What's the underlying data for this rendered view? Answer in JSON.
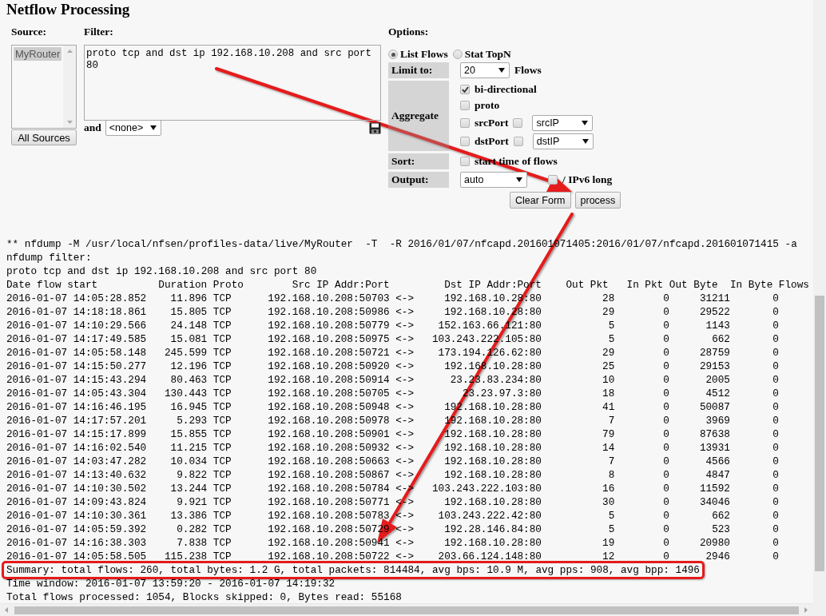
{
  "title": "Netflow Processing",
  "source": {
    "label": "Source:",
    "items": [
      {
        "label": "MyRouter",
        "selected": true
      }
    ],
    "button": "All Sources"
  },
  "filter": {
    "label": "Filter:",
    "value": "proto tcp and dst ip 192.168.10.208 and src port 80",
    "and_label": "and",
    "and_select": "<none>"
  },
  "options": {
    "label": "Options:",
    "modes": [
      {
        "label": "List Flows",
        "selected": true
      },
      {
        "label": "Stat TopN",
        "selected": false
      }
    ],
    "limit": {
      "label": "Limit to:",
      "select": "20",
      "unit": "Flows"
    },
    "aggregate": {
      "label": "Aggregate",
      "items": [
        {
          "kind": "check",
          "label": "bi-directional",
          "checked": true
        },
        {
          "kind": "check",
          "label": "proto",
          "checked": false
        },
        {
          "kind": "check_select",
          "label": "srcPort",
          "checked": false,
          "second_checked": false,
          "select": "srcIP"
        },
        {
          "kind": "check_select",
          "label": "dstPort",
          "checked": false,
          "second_checked": false,
          "select": "dstIP"
        }
      ]
    },
    "sort": {
      "label": "Sort:",
      "checked": false,
      "text": "start time of flows"
    },
    "output": {
      "label": "Output:",
      "select": "auto",
      "ipv6_checked": false,
      "ipv6_label": "/ IPv6 long"
    }
  },
  "buttons": [
    "Clear Form",
    "process"
  ],
  "result": {
    "command": "** nfdump -M /usr/local/nfsen/profiles-data/live/MyRouter  -T  -R 2016/01/07/nfcapd.201601071405:2016/01/07/nfcapd.201601071415 -a",
    "filter_label": "nfdump filter:",
    "filter": "proto tcp and dst ip 192.168.10.208 and src port 80",
    "columns": [
      "Date flow start",
      "Duration",
      "Proto",
      "Src IP Addr:Port",
      "",
      "Dst IP Addr:Port",
      "Out Pkt",
      "In Pkt",
      "Out Byte",
      "In Byte",
      "Flows"
    ],
    "rows": [
      [
        "2016-01-07 14:05:28.852",
        "11.896",
        "TCP",
        "192.168.10.208:50703",
        "<->",
        "192.168.10.28:80",
        "28",
        "0",
        "31211",
        "0"
      ],
      [
        "2016-01-07 14:18:18.861",
        "15.805",
        "TCP",
        "192.168.10.208:50986",
        "<->",
        "192.168.10.28:80",
        "29",
        "0",
        "29522",
        "0"
      ],
      [
        "2016-01-07 14:10:29.566",
        "24.148",
        "TCP",
        "192.168.10.208:50779",
        "<->",
        "152.163.66.121:80",
        "5",
        "0",
        "1143",
        "0"
      ],
      [
        "2016-01-07 14:17:49.585",
        "15.081",
        "TCP",
        "192.168.10.208:50975",
        "<->",
        "103.243.222.105:80",
        "5",
        "0",
        "662",
        "0"
      ],
      [
        "2016-01-07 14:05:58.148",
        "245.599",
        "TCP",
        "192.168.10.208:50721",
        "<->",
        "173.194.126.62:80",
        "29",
        "0",
        "28759",
        "0"
      ],
      [
        "2016-01-07 14:15:50.277",
        "12.196",
        "TCP",
        "192.168.10.208:50920",
        "<->",
        "192.168.10.28:80",
        "25",
        "0",
        "29153",
        "0"
      ],
      [
        "2016-01-07 14:15:43.294",
        "80.463",
        "TCP",
        "192.168.10.208:50914",
        "<->",
        "23.23.83.234:80",
        "10",
        "0",
        "2005",
        "0"
      ],
      [
        "2016-01-07 14:05:43.304",
        "130.443",
        "TCP",
        "192.168.10.208:50705",
        "<->",
        "23.23.97.3:80",
        "18",
        "0",
        "4512",
        "0"
      ],
      [
        "2016-01-07 14:16:46.195",
        "16.945",
        "TCP",
        "192.168.10.208:50948",
        "<->",
        "192.168.10.28:80",
        "41",
        "0",
        "50087",
        "0"
      ],
      [
        "2016-01-07 14:17:57.201",
        "5.293",
        "TCP",
        "192.168.10.208:50978",
        "<->",
        "192.168.10.28:80",
        "7",
        "0",
        "3969",
        "0"
      ],
      [
        "2016-01-07 14:15:17.899",
        "15.855",
        "TCP",
        "192.168.10.208:50901",
        "<->",
        "192.168.10.28:80",
        "79",
        "0",
        "87638",
        "0"
      ],
      [
        "2016-01-07 14:16:02.540",
        "11.215",
        "TCP",
        "192.168.10.208:50932",
        "<->",
        "192.168.10.28:80",
        "14",
        "0",
        "13931",
        "0"
      ],
      [
        "2016-01-07 14:03:47.282",
        "10.034",
        "TCP",
        "192.168.10.208:50663",
        "<->",
        "192.168.10.28:80",
        "7",
        "0",
        "4566",
        "0"
      ],
      [
        "2016-01-07 14:13:40.632",
        "9.822",
        "TCP",
        "192.168.10.208:50867",
        "<->",
        "192.168.10.28:80",
        "8",
        "0",
        "4847",
        "0"
      ],
      [
        "2016-01-07 14:10:30.502",
        "13.244",
        "TCP",
        "192.168.10.208:50784",
        "<->",
        "103.243.222.103:80",
        "16",
        "0",
        "11592",
        "0"
      ],
      [
        "2016-01-07 14:09:43.824",
        "9.921",
        "TCP",
        "192.168.10.208:50771",
        "<->",
        "192.168.10.28:80",
        "30",
        "0",
        "34046",
        "0"
      ],
      [
        "2016-01-07 14:10:30.361",
        "13.386",
        "TCP",
        "192.168.10.208:50783",
        "<->",
        "103.243.222.42:80",
        "5",
        "0",
        "662",
        "0"
      ],
      [
        "2016-01-07 14:05:59.392",
        "0.282",
        "TCP",
        "192.168.10.208:50729",
        "<->",
        "192.28.146.84:80",
        "5",
        "0",
        "523",
        "0"
      ],
      [
        "2016-01-07 14:16:38.303",
        "7.838",
        "TCP",
        "192.168.10.208:50941",
        "<->",
        "192.168.10.28:80",
        "19",
        "0",
        "20980",
        "0"
      ],
      [
        "2016-01-07 14:05:58.505",
        "115.238",
        "TCP",
        "192.168.10.208:50722",
        "<->",
        "203.66.124.148:80",
        "12",
        "0",
        "2946",
        "0"
      ]
    ],
    "summary": {
      "text": "Summary: total flows: 260, total bytes: 1.2 G, total packets: 814484, avg bps: 10.9 M, avg pps: 908, avg bpp: 1496",
      "highlighted": true
    },
    "lines": [
      "Time window: 2016-01-07 13:59:20 - 2016-01-07 14:19:32",
      "Total flows processed: 1054, Blocks skipped: 0, Bytes read: 55168"
    ]
  }
}
